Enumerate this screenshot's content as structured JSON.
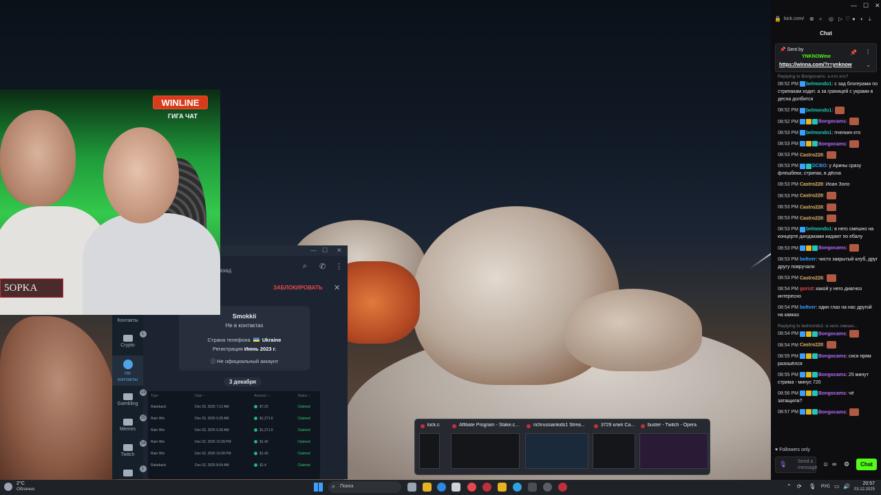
{
  "webcam": {
    "sponsor": "WINLINE",
    "sponsor_sub": "ГИГА ЧАТ",
    "nametag": "5OPKA"
  },
  "telegram": {
    "back_text": "азад",
    "block_label": "ЗАБЛОКИРОВАТЬ",
    "folders": [
      {
        "label": "Контакты",
        "badge": ""
      },
      {
        "label": "Crypto",
        "badge": "1"
      },
      {
        "label": "Не контакты",
        "badge": ""
      },
      {
        "label": "Gambling",
        "badge": "13"
      },
      {
        "label": "Memes",
        "badge": "15"
      },
      {
        "label": "Twitch",
        "badge": "14"
      },
      {
        "label": "",
        "badge": "1"
      }
    ],
    "card": {
      "name": "Smokkii",
      "status": "Не в контактах",
      "phone_label": "Страна телефона",
      "phone_value": "Ukraine",
      "reg_label": "Регистрация",
      "reg_value": "Июнь 2023 г.",
      "official": "Не официальный аккаунт"
    },
    "date_pill": "3 декабря",
    "table": {
      "headers": [
        "Type",
        "Date ↑",
        "Amount ↑↓",
        "Status ↑"
      ],
      "rows": [
        [
          "Rakeback",
          "Dec 03, 2025 7:12 AM",
          "$7.22",
          "Claimed"
        ],
        [
          "Rain Win",
          "Dec 03, 2025 5:28 AM",
          "$1,271.6",
          "Claimed"
        ],
        [
          "Rain Win",
          "Dec 03, 2025 5:28 AM",
          "$1,271.6",
          "Claimed"
        ],
        [
          "Rain Win",
          "Dec 02, 2025 10:28 PM",
          "$1.42",
          "Claimed"
        ],
        [
          "Rain Win",
          "Dec 02, 2025 10:28 PM",
          "$1.42",
          "Claimed"
        ],
        [
          "Rakeback",
          "Dec 02, 2025 8:04 AM",
          "$1.4",
          "Claimed"
        ]
      ]
    }
  },
  "chat": {
    "url": "kick.com/",
    "title": "Chat",
    "pinned": {
      "sent_by": "Sent by",
      "user": "YNKNOWme",
      "link": "https://winna.com/?r=ynknow"
    },
    "messages": [
      {
        "reply": "Replying to Bongocams: а кто это?",
        "time": "08:52 PM",
        "user": "belmondo1",
        "color": "#22c7b8",
        "text": ": с зад блогерами по стрипакам ходит. а за границей с украми в десна долбится",
        "emote": false,
        "badges": [
          "blue"
        ]
      },
      {
        "reply": "",
        "time": "08:52 PM",
        "user": "belmondo1",
        "color": "#22c7b8",
        "text": ":",
        "emote": true,
        "badges": [
          "blue"
        ]
      },
      {
        "reply": "",
        "time": "08:52 PM",
        "user": "Bongocams",
        "color": "#b36cff",
        "text": ":",
        "emote": true,
        "badges": [
          "blue",
          "gold",
          "teal"
        ]
      },
      {
        "reply": "",
        "time": "08:53 PM",
        "user": "belmondo1",
        "color": "#22c7b8",
        "text": ": пчелкин кто",
        "emote": false,
        "badges": [
          "blue"
        ]
      },
      {
        "reply": "",
        "time": "08:53 PM",
        "user": "Bongocams",
        "color": "#b36cff",
        "text": ":",
        "emote": true,
        "badges": [
          "blue",
          "gold",
          "teal"
        ]
      },
      {
        "reply": "",
        "time": "08:53 PM",
        "user": "Castro228",
        "color": "#e6b46a",
        "text": ":",
        "emote": true,
        "badges": []
      },
      {
        "reply": "",
        "time": "08:53 PM",
        "user": "DCBO",
        "color": "#3aa0ff",
        "text": ": у Арины сразу флешбеки, стрипак, в дёсна",
        "emote": false,
        "badges": [
          "blue",
          "teal"
        ]
      },
      {
        "reply": "",
        "time": "08:53 PM",
        "user": "Castro228",
        "color": "#e6b46a",
        "text": ": Иоан Золо",
        "emote": false,
        "badges": []
      },
      {
        "reply": "",
        "time": "08:53 PM",
        "user": "Castro228",
        "color": "#e6b46a",
        "text": ":",
        "emote": true,
        "badges": []
      },
      {
        "reply": "",
        "time": "08:53 PM",
        "user": "Castro228",
        "color": "#e6b46a",
        "text": ":",
        "emote": true,
        "badges": []
      },
      {
        "reply": "",
        "time": "08:53 PM",
        "user": "Castro228",
        "color": "#e6b46a",
        "text": ":",
        "emote": true,
        "badges": []
      },
      {
        "reply": "",
        "time": "08:53 PM",
        "user": "belmondo1",
        "color": "#22c7b8",
        "text": ": в него смешно на концерте дилдаками кидают по ебалу",
        "emote": false,
        "badges": [
          "blue"
        ]
      },
      {
        "reply": "",
        "time": "08:53 PM",
        "user": "Bongocams",
        "color": "#b36cff",
        "text": ":",
        "emote": true,
        "badges": [
          "blue",
          "gold",
          "teal"
        ]
      },
      {
        "reply": "",
        "time": "08:53 PM",
        "user": "boltver",
        "color": "#3aa0ff",
        "text": ": чисто закрытый клуб, друг другу повручали",
        "emote": false,
        "badges": []
      },
      {
        "reply": "",
        "time": "08:53 PM",
        "user": "Castro228",
        "color": "#e6b46a",
        "text": ":",
        "emote": true,
        "badges": []
      },
      {
        "reply": "",
        "time": "08:54 PM",
        "user": "gorist",
        "color": "#e5484d",
        "text": ": какой у него диагноз интересно",
        "emote": false,
        "badges": []
      },
      {
        "reply": "",
        "time": "08:54 PM",
        "user": "boltver",
        "color": "#3aa0ff",
        "text": ": один глаз на нас другой на кавказ",
        "emote": false,
        "badges": []
      },
      {
        "reply": "Replying to belmondo1: в него смешн...",
        "time": "08:54 PM",
        "user": "Bongocams",
        "color": "#b36cff",
        "text": ":",
        "emote": true,
        "badges": [
          "blue",
          "gold",
          "teal"
        ]
      },
      {
        "reply": "",
        "time": "08:54 PM",
        "user": "Castro228",
        "color": "#e6b46a",
        "text": ":",
        "emote": true,
        "badges": []
      },
      {
        "reply": "",
        "time": "08:55 PM",
        "user": "Bongocams",
        "color": "#b36cff",
        "text": ": сяся прям разошёлся",
        "emote": false,
        "badges": [
          "blue",
          "gold",
          "teal"
        ]
      },
      {
        "reply": "",
        "time": "08:55 PM",
        "user": "Bongocams",
        "color": "#b36cff",
        "text": ": 25 минут стрима - минус 720",
        "emote": false,
        "badges": [
          "blue",
          "gold",
          "teal"
        ]
      },
      {
        "reply": "",
        "time": "08:56 PM",
        "user": "Bongocams",
        "color": "#b36cff",
        "text": ": чё затащила?",
        "emote": false,
        "badges": [
          "blue",
          "gold",
          "teal"
        ]
      },
      {
        "reply": "",
        "time": "08:57 PM",
        "user": "Bongocams",
        "color": "#b36cff",
        "text": ":",
        "emote": true,
        "badges": [
          "blue",
          "gold",
          "teal"
        ]
      }
    ],
    "followers_only": "Followers only",
    "send_placeholder": "Send a message",
    "chat_button": "Chat"
  },
  "previews": [
    {
      "title": "kick.co..."
    },
    {
      "title": "Affiliate Program - Stake.c..."
    },
    {
      "title": "richrussiankids1 Strea..."
    },
    {
      "title": "3729 клип Ca..."
    },
    {
      "title": "buster - Twitch - Opera"
    }
  ],
  "taskbar": {
    "temp": "2°C",
    "condition": "Облачно",
    "search_placeholder": "Поиск",
    "lang": "РУС",
    "time": "20:57",
    "date": "03.12.2025"
  }
}
